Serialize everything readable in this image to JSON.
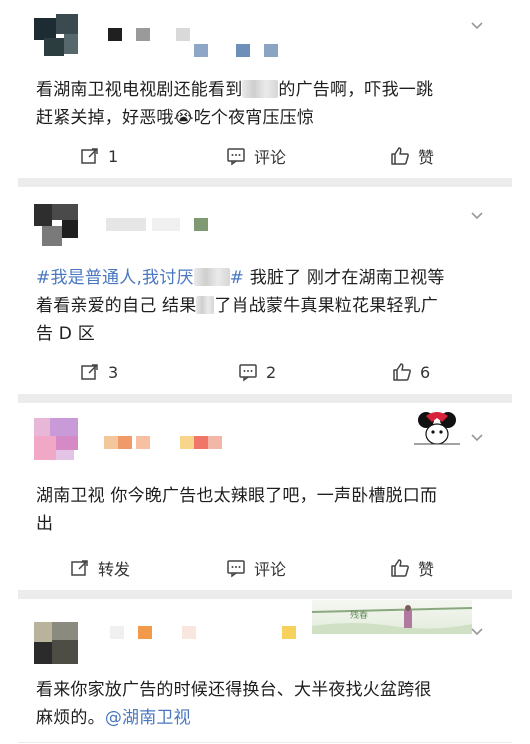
{
  "posts": [
    {
      "text_a": "看湖南卫视电视剧还能看到",
      "text_b": "的广告啊，吓我一跳\n赶紧关掉，好恶哦",
      "emoji": "😭",
      "text_c": "吃个夜宵压压惊",
      "actions": {
        "share": "1",
        "comment": "评论",
        "like": "赞"
      }
    },
    {
      "tag": "#我是普通人,我讨厌",
      "tag_end": "#",
      "text_b": "我脏了 刚才在湖南卫视等\n着看亲爱的自己 结果",
      "text_c": "了肖战蒙牛真果粒花果轻乳广\n告 D 区",
      "actions": {
        "share": "3",
        "comment": "2",
        "like": "6"
      }
    },
    {
      "text_a": "湖南卫视 你今晚广告也太辣眼了吧，一声卧槽脱口而\n出",
      "actions": {
        "share": "转发",
        "comment": "评论",
        "like": "赞"
      }
    },
    {
      "text_a": "看来你家放广告的时候还得换台、大半夜找火盆跨很\n麻烦的。",
      "mention": "@湖南卫视",
      "banner_text": "残春"
    }
  ],
  "colors": {
    "link": "#4a77c1",
    "separator": "#ececec"
  },
  "icons": [
    "share-icon",
    "comment-icon",
    "like-icon",
    "chevron-down-icon"
  ]
}
